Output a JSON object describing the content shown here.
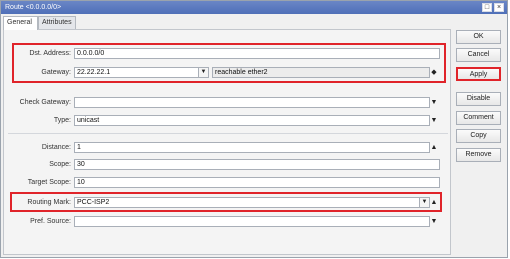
{
  "window": {
    "title": "Route <0.0.0.0/0>"
  },
  "titlebar_buttons": {
    "restore": "□",
    "close": "×"
  },
  "tabs": [
    {
      "label": "General"
    },
    {
      "label": "Attributes"
    }
  ],
  "form": {
    "dst_address": {
      "label": "Dst. Address:",
      "value": "0.0.0.0/0"
    },
    "gateway": {
      "label": "Gateway:",
      "value": "22.22.22.1",
      "status": "reachable ether2"
    },
    "check_gateway": {
      "label": "Check Gateway:",
      "value": ""
    },
    "type": {
      "label": "Type:",
      "value": "unicast"
    },
    "distance": {
      "label": "Distance:",
      "value": "1"
    },
    "scope": {
      "label": "Scope:",
      "value": "30"
    },
    "target_scope": {
      "label": "Target Scope:",
      "value": "10"
    },
    "routing_mark": {
      "label": "Routing Mark:",
      "value": "PCC-ISP2"
    },
    "pref_source": {
      "label": "Pref. Source:",
      "value": ""
    }
  },
  "glyphs": {
    "dropdown": "▼",
    "up": "▲",
    "updown": "◆",
    "mini_dropdown": "▼"
  },
  "buttons": {
    "ok": "OK",
    "cancel": "Cancel",
    "apply": "Apply",
    "disable": "Disable",
    "comment": "Comment",
    "copy": "Copy",
    "remove": "Remove"
  },
  "colors": {
    "highlight": "#e0242a",
    "titlebar": "#5474bd"
  }
}
